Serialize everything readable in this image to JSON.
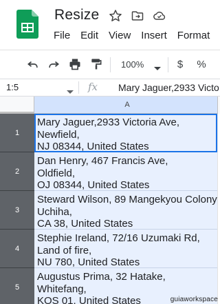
{
  "document": {
    "title": "Resize"
  },
  "menu": [
    "File",
    "Edit",
    "View",
    "Insert",
    "Format"
  ],
  "toolbar": {
    "zoom": "100%",
    "currency": "$",
    "percent": "%"
  },
  "formula_bar": {
    "name_box": "1:5",
    "fx_label": "fx",
    "value": "Mary Jaguer,2933 Victo"
  },
  "grid": {
    "column_header": "A",
    "rows": [
      {
        "number": "1",
        "lines": [
          "Mary Jaguer,2933 Victoria Ave,",
          "Newfield,",
          "NJ 08344, United States"
        ]
      },
      {
        "number": "2",
        "lines": [
          "Dan Henry, 467 Francis Ave,",
          "Oldfield,",
          "OJ 08344, United States"
        ]
      },
      {
        "number": "3",
        "lines": [
          "Steward Wilson, 89 Mangekyou Colony,",
          "Uchiha,",
          "CA 38, United States"
        ]
      },
      {
        "number": "4",
        "lines": [
          "Stephie Ireland, 72/16 Uzumaki Rd,",
          "Land of fire,",
          "NU 780, United States"
        ]
      },
      {
        "number": "5",
        "lines": [
          "Augustus Prima, 32 Hatake,",
          "Whitefang,",
          "KOS 01, United States"
        ]
      }
    ]
  },
  "watermark": "guiaworkspace",
  "colors": {
    "sheets_green": "#0f9d58",
    "selection_blue": "#1a73e8",
    "selected_fill": "#e8f0fe",
    "row_header_selected": "#5f6368"
  }
}
